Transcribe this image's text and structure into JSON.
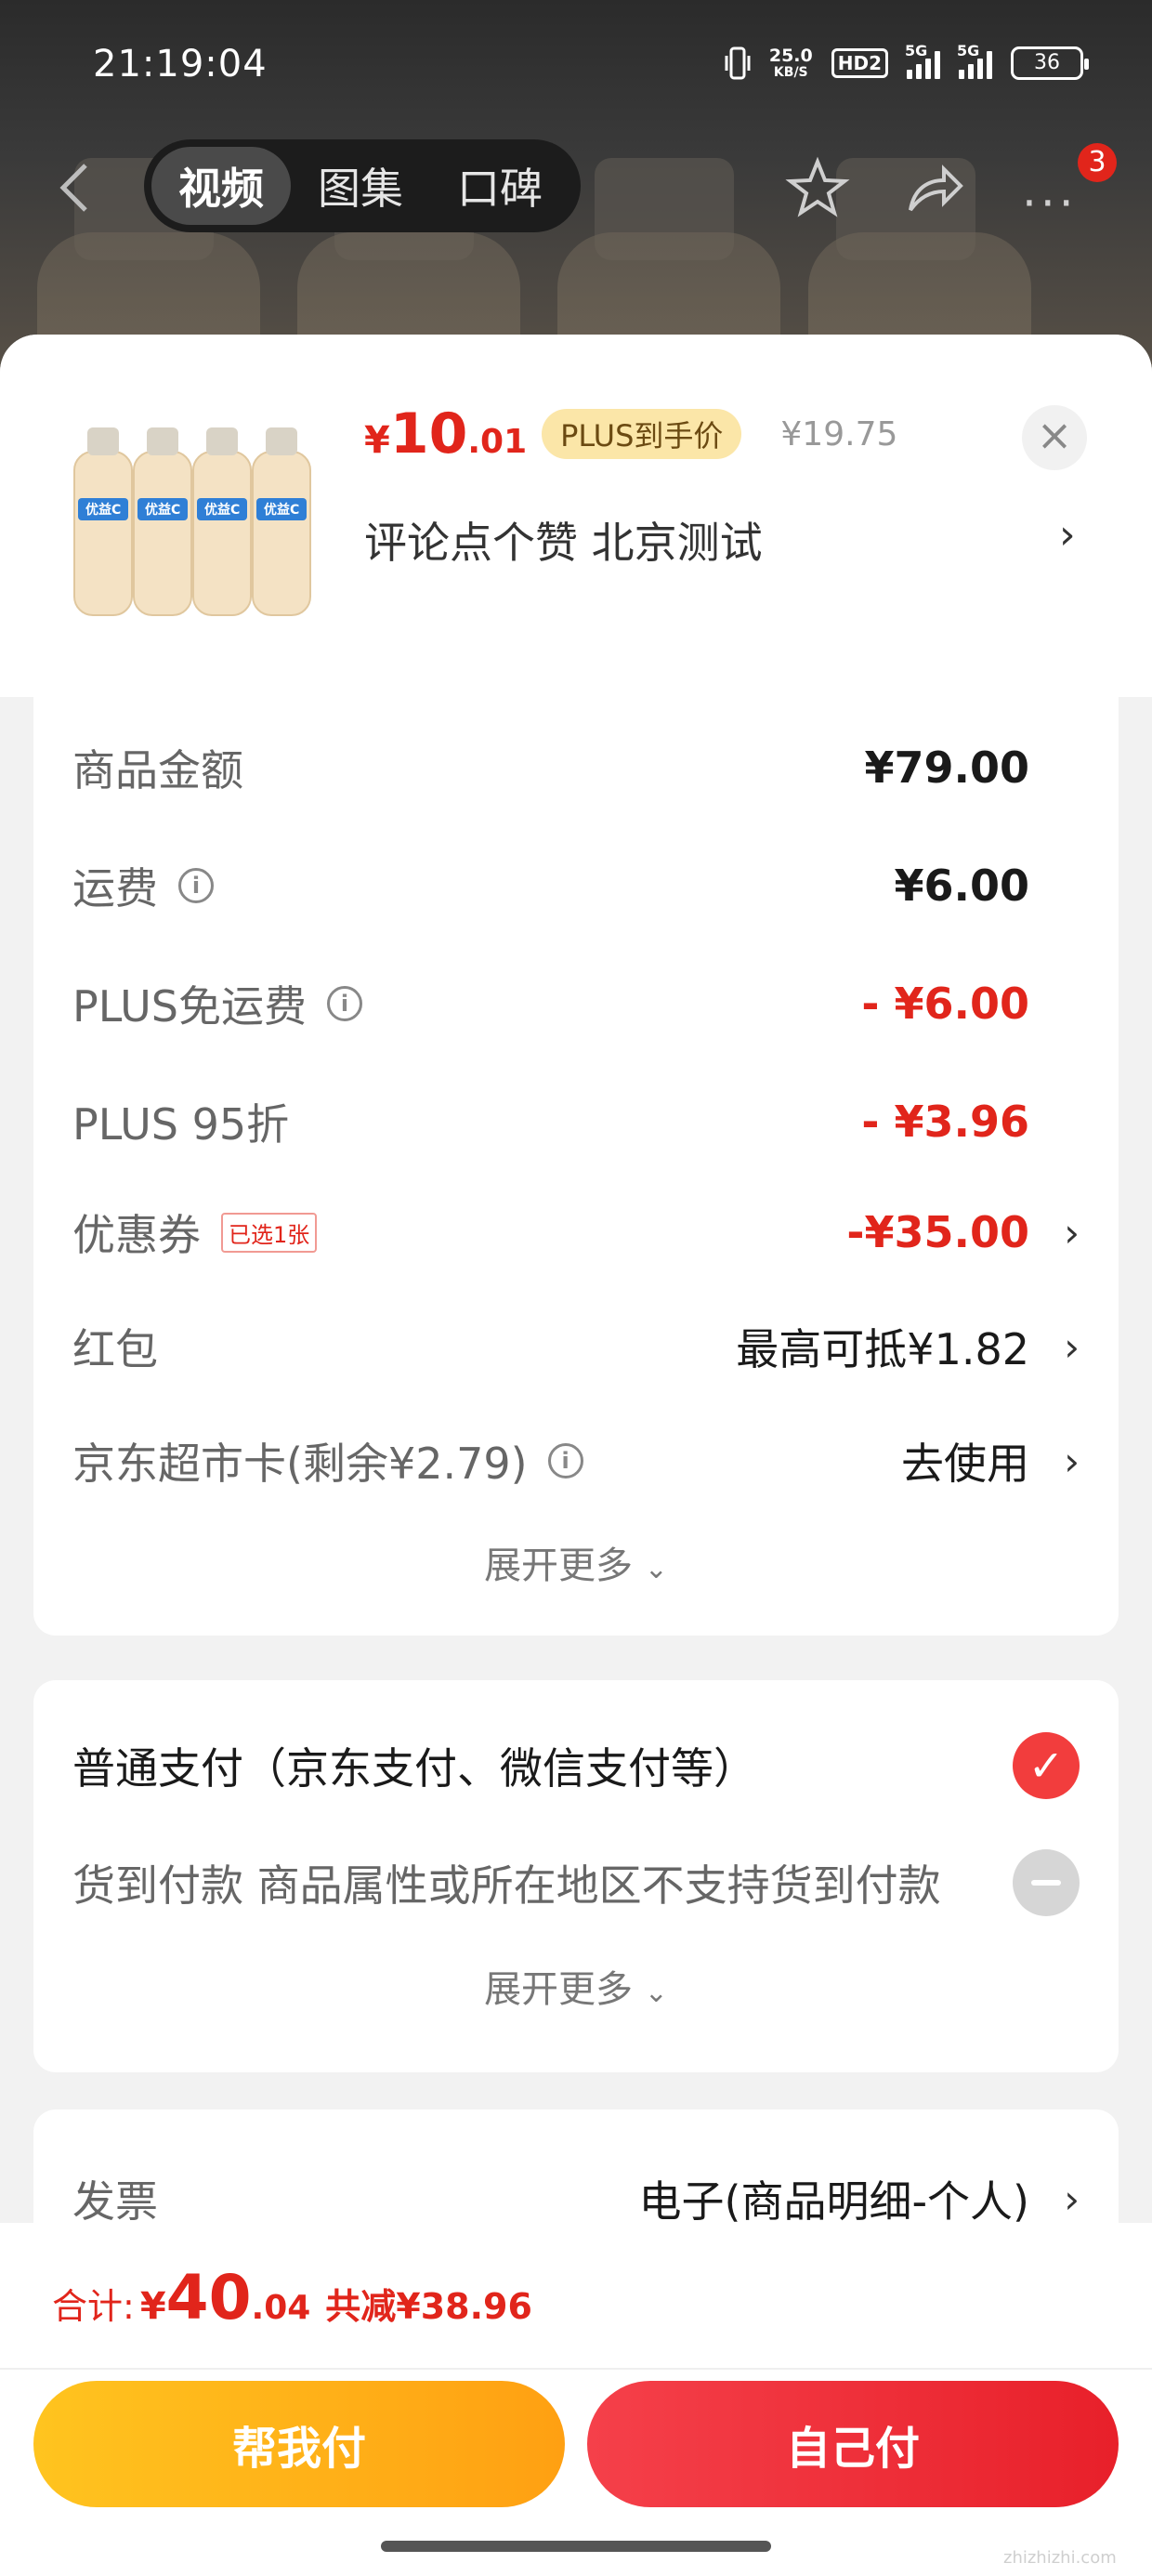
{
  "status_bar": {
    "time": "21:19:04",
    "net_speed_value": "25.0",
    "net_speed_unit": "KB/S",
    "hd_badge": "HD2",
    "signal_1_label": "5G",
    "signal_2_label": "5G",
    "battery": "36"
  },
  "nav": {
    "tabs": [
      "视频",
      "图集",
      "口碑"
    ],
    "active_tab": "视频",
    "more_badge": "3"
  },
  "product": {
    "price_symbol": "¥",
    "price_integer": "10",
    "price_decimal": ".01",
    "plus_badge": "PLUS到手价",
    "original_price": "¥19.75",
    "subtitle": "评论点个赞  北京测试",
    "image_label": "优益C"
  },
  "costs": {
    "rows": [
      {
        "label": "商品金额",
        "value": "¥79.00"
      },
      {
        "label": "运费",
        "value": "¥6.00"
      },
      {
        "label": "PLUS免运费",
        "value": "- ¥6.00"
      },
      {
        "label": "PLUS 95折",
        "value": "- ¥3.96"
      },
      {
        "label": "优惠券",
        "tag": "已选1张",
        "value": "-¥35.00"
      },
      {
        "label": "红包",
        "value": "最高可抵¥1.82"
      },
      {
        "label": "京东超市卡(剩余¥2.79)",
        "value": "去使用"
      }
    ],
    "expand_label": "展开更多"
  },
  "payment": {
    "option_normal": "普通支付（京东支付、微信支付等）",
    "option_cod": "货到付款  商品属性或所在地区不支持货到付款",
    "expand_label": "展开更多"
  },
  "invoice": {
    "label": "发票",
    "value": "电子(商品明细-个人)"
  },
  "total": {
    "label": "合计:",
    "symbol": "¥",
    "integer": "40",
    "decimal": ".04",
    "saved": "共减¥38.96"
  },
  "buttons": {
    "help_pay": "帮我付",
    "self_pay": "自己付"
  },
  "watermark": "zhizhizhi.com",
  "colors": {
    "accent_red": "#e1251b",
    "plus_gold": "#fbe6a8",
    "help_pay_yellow": "#ffb31a",
    "self_pay_red": "#f0303a"
  }
}
